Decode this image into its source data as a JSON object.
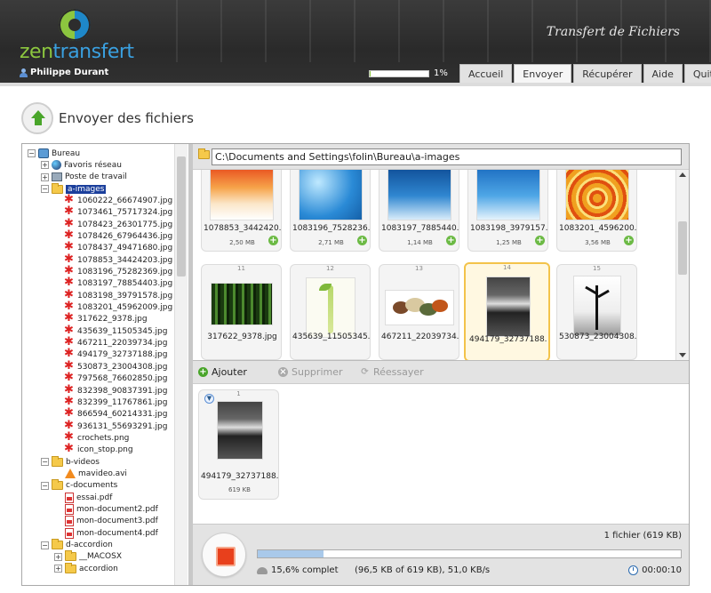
{
  "header": {
    "logo_text": "zentransfert",
    "app_title": "Transfert de Fichiers",
    "user_name": "Philippe Durant",
    "upload_progress_pct": 1,
    "upload_progress_label": "1%",
    "tabs": [
      {
        "label": "Accueil"
      },
      {
        "label": "Envoyer",
        "active": true
      },
      {
        "label": "Récupérer"
      },
      {
        "label": "Aide"
      },
      {
        "label": "Quitter"
      }
    ]
  },
  "page_title": "Envoyer des fichiers",
  "tree": {
    "items": [
      "Bureau",
      "Favoris réseau",
      "Poste de travail",
      "a-images",
      "1060222_66674907.jpg",
      "1073461_75717324.jpg",
      "1078423_26301775.jpg",
      "1078426_67964436.jpg",
      "1078437_49471680.jpg",
      "1078853_34424203.jpg",
      "1083196_75282369.jpg",
      "1083197_78854403.jpg",
      "1083198_39791578.jpg",
      "1083201_45962009.jpg",
      "317622_9378.jpg",
      "435639_11505345.jpg",
      "467211_22039734.jpg",
      "494179_32737188.jpg",
      "530873_23004308.jpg",
      "797568_76602850.jpg",
      "832398_90837391.jpg",
      "832399_11767861.jpg",
      "866594_60214331.jpg",
      "936131_55693291.jpg",
      "crochets.png",
      "icon_stop.png",
      "b-videos",
      "mavideo.avi",
      "c-documents",
      "essai.pdf",
      "mon-document2.pdf",
      "mon-document3.pdf",
      "mon-document4.pdf",
      "d-accordion",
      "__MACOSX",
      "accordion"
    ]
  },
  "path": "C:\\Documents and Settings\\folin\\Bureau\\a-images",
  "grid": {
    "row1": [
      {
        "name": "1078853_3442420...",
        "size": "2,50 MB"
      },
      {
        "name": "1083196_7528236...",
        "size": "2,71 MB"
      },
      {
        "name": "1083197_7885440...",
        "size": "1,14 MB"
      },
      {
        "name": "1083198_3979157...",
        "size": "1,25 MB"
      },
      {
        "name": "1083201_4596200...",
        "size": "3,56 MB"
      }
    ],
    "row2": [
      {
        "num": "11",
        "name": "317622_9378.jpg"
      },
      {
        "num": "12",
        "name": "435639_11505345..."
      },
      {
        "num": "13",
        "name": "467211_22039734..."
      },
      {
        "num": "14",
        "name": "494179_32737188..."
      },
      {
        "num": "15",
        "name": "530873_23004308..."
      }
    ]
  },
  "toolbar": {
    "add_label": "Ajouter",
    "delete_label": "Supprimer",
    "retry_label": "Réessayer"
  },
  "queue": {
    "items": [
      {
        "num": "1",
        "name": "494179_32737188...",
        "size": "619 KB"
      }
    ]
  },
  "status": {
    "file_count": "1 fichier (619 KB)",
    "progress_pct": 15.6,
    "complete_label": "15,6% complet",
    "detail": "(96,5 KB of 619 KB), 51,0 KB/s",
    "elapsed": "00:00:10"
  }
}
